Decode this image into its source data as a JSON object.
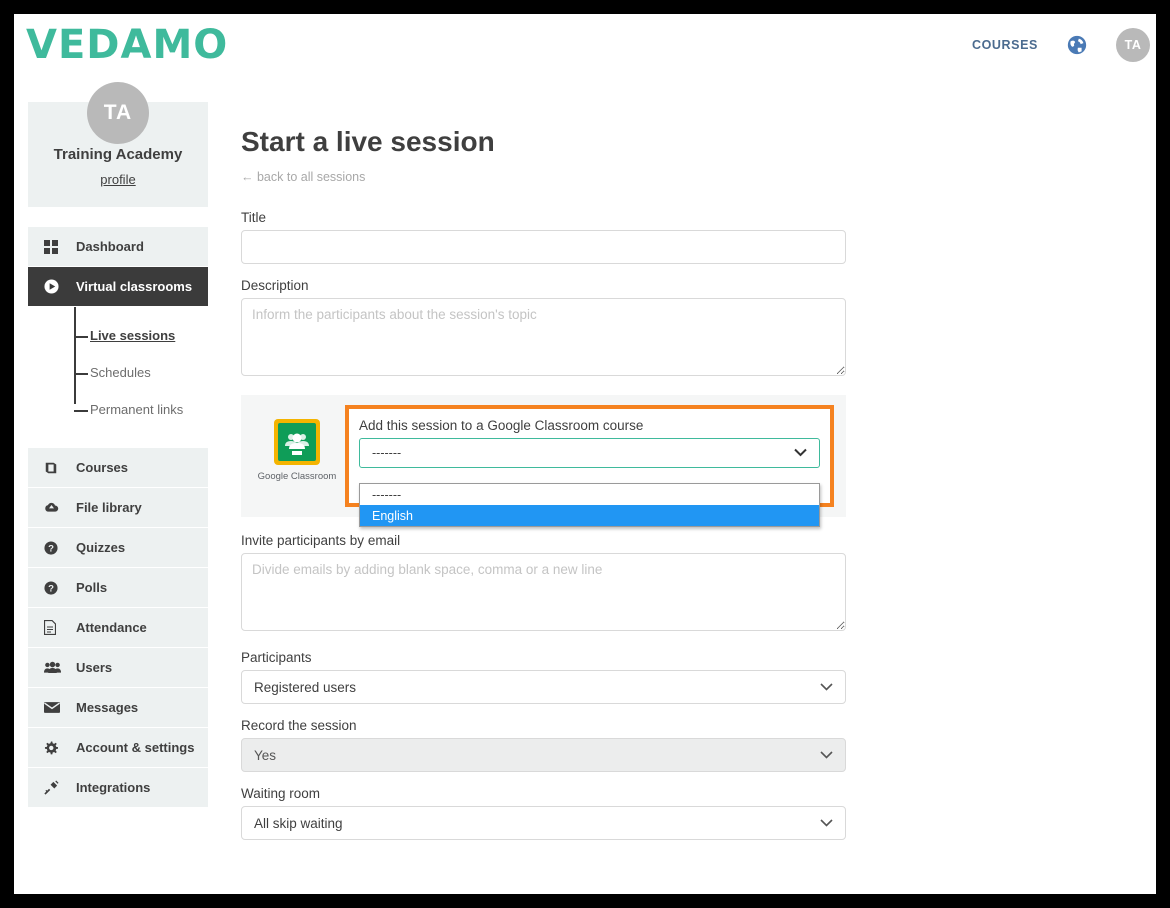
{
  "brand": {
    "logo_text": "VEDAMO",
    "logo_color": "#3fba9c"
  },
  "topnav": {
    "courses_label": "COURSES",
    "globe_icon": "globe-icon",
    "avatar_initials": "TA"
  },
  "sidebar": {
    "profile": {
      "avatar_initials": "TA",
      "name": "Training Academy",
      "profile_link": "profile"
    },
    "items": [
      {
        "label": "Dashboard",
        "icon": "grid-icon",
        "active": false
      },
      {
        "label": "Virtual classrooms",
        "icon": "play-circle-icon",
        "active": true
      },
      {
        "label": "Courses",
        "icon": "book-icon",
        "active": false
      },
      {
        "label": "File library",
        "icon": "cloud-upload-icon",
        "active": false
      },
      {
        "label": "Quizzes",
        "icon": "question-circle-icon",
        "active": false
      },
      {
        "label": "Polls",
        "icon": "question-circle-icon",
        "active": false
      },
      {
        "label": "Attendance",
        "icon": "document-icon",
        "active": false
      },
      {
        "label": "Users",
        "icon": "users-icon",
        "active": false
      },
      {
        "label": "Messages",
        "icon": "envelope-icon",
        "active": false
      },
      {
        "label": "Account & settings",
        "icon": "gear-icon",
        "active": false
      },
      {
        "label": "Integrations",
        "icon": "plug-icon",
        "active": false
      }
    ],
    "subitems": [
      {
        "label": "Live sessions",
        "active": true
      },
      {
        "label": "Schedules",
        "active": false
      },
      {
        "label": "Permanent links",
        "active": false
      }
    ]
  },
  "main": {
    "page_title": "Start a live session",
    "back_link": "← back to all sessions",
    "fields": {
      "title": {
        "label": "Title",
        "value": "",
        "placeholder": ""
      },
      "description": {
        "label": "Description",
        "value": "",
        "placeholder": "Inform the participants about the session's topic"
      },
      "invite": {
        "label": "Invite participants by email",
        "value": "",
        "placeholder": "Divide emails by adding blank space, comma or a new line"
      },
      "participants": {
        "label": "Participants",
        "value": "Registered users"
      },
      "record": {
        "label": "Record the session",
        "value": "Yes",
        "disabled": true
      },
      "waiting_room": {
        "label": "Waiting room",
        "value": "All skip waiting"
      }
    },
    "google_classroom": {
      "caption": "Google Classroom",
      "field_label": "Add this session to a Google Classroom course",
      "selected_value": "-------",
      "options": [
        "-------",
        "English"
      ],
      "highlighted_option": "English",
      "highlight_color": "#f58220",
      "focus_border_color": "#3fba9c",
      "option_highlight_color": "#2196f3"
    }
  }
}
